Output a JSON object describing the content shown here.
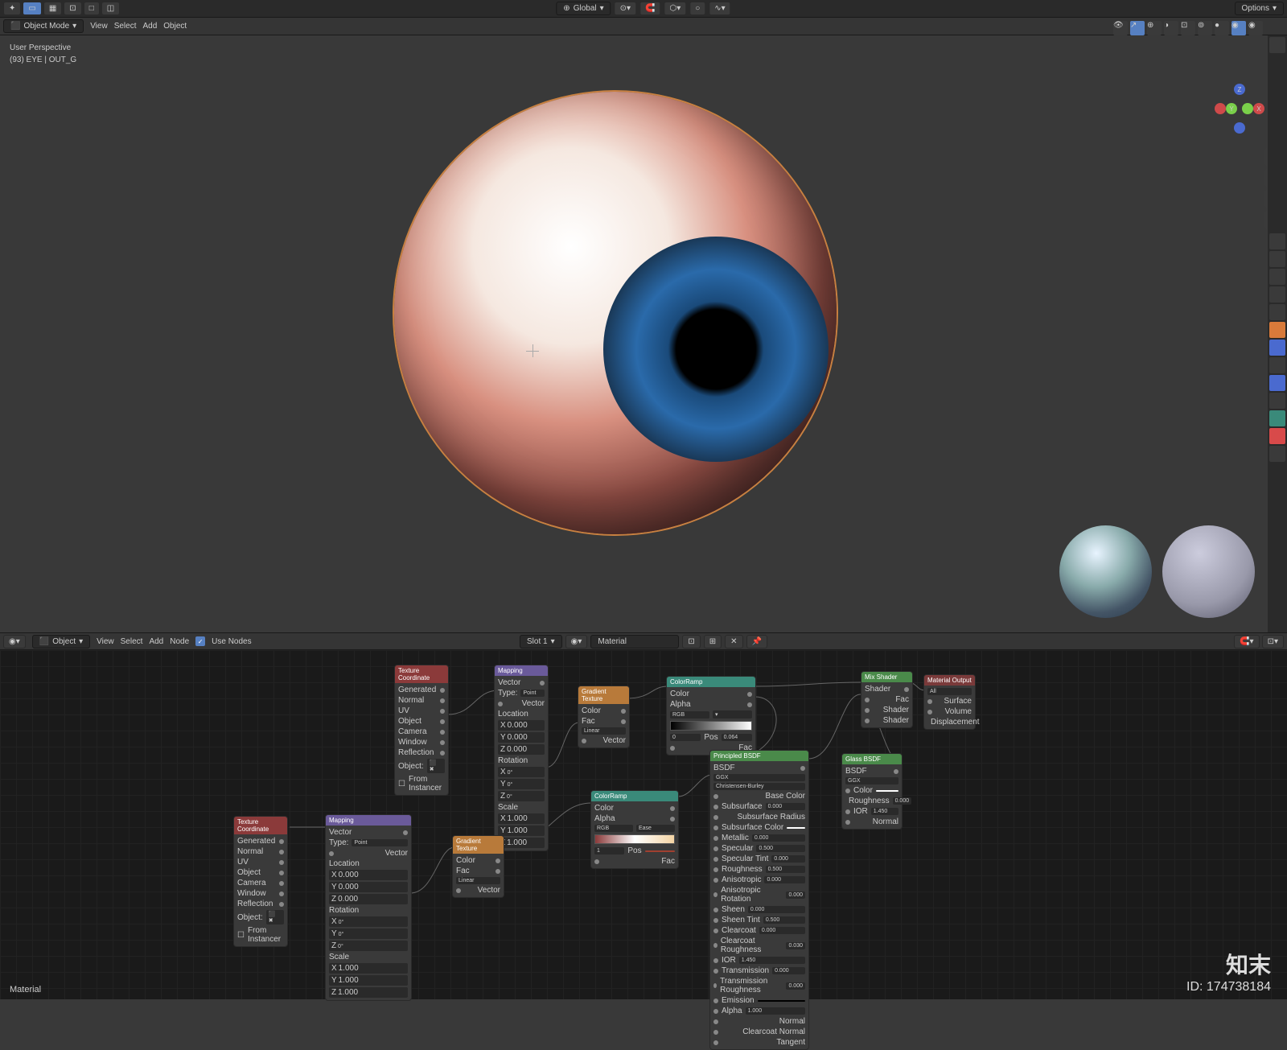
{
  "topbar": {
    "orientation": "Global",
    "options": "Options"
  },
  "header": {
    "mode": "Object Mode",
    "view": "View",
    "select": "Select",
    "add": "Add",
    "object": "Object"
  },
  "viewport": {
    "perspective": "User Perspective",
    "collection": "(93) EYE | OUT_G"
  },
  "nodeHeader": {
    "object": "Object",
    "view": "View",
    "select": "Select",
    "add": "Add",
    "node": "Node",
    "useNodes": "Use Nodes",
    "slot": "Slot 1",
    "material": "Material"
  },
  "nodes": {
    "texcoord": {
      "title": "Texture Coordinate",
      "outs": [
        "Generated",
        "Normal",
        "UV",
        "Object",
        "Camera",
        "Window",
        "Reflection"
      ],
      "obj": "Object:",
      "fi": "From Instancer"
    },
    "mapping": {
      "title": "Mapping",
      "vectorOut": "Vector",
      "type": "Type:",
      "point": "Point",
      "vector": "Vector",
      "location": "Location",
      "rotation": "Rotation",
      "scale": "Scale",
      "x": "X",
      "y": "Y",
      "z": "Z",
      "v0": "0.000",
      "v1": "1.000"
    },
    "gradtex": {
      "title": "Gradient Texture",
      "color": "Color",
      "fac": "Fac",
      "linear": "Linear",
      "vector": "Vector"
    },
    "colorramp1": {
      "title": "ColorRamp",
      "color": "Color",
      "alpha": "Alpha",
      "rgb": "RGB",
      "pos": "Pos",
      "posv": "0.064",
      "fac": "Fac"
    },
    "colorramp2": {
      "title": "ColorRamp",
      "color": "Color",
      "alpha": "Alpha",
      "rgb": "RGB",
      "ease": "Ease",
      "pos": "Pos",
      "fac": "Fac"
    },
    "mix": {
      "title": "Mix Shader",
      "shader": "Shader",
      "fac": "Fac"
    },
    "matout": {
      "title": "Material Output",
      "surface": "Surface",
      "volume": "Volume",
      "displacement": "Displacement",
      "all": "All"
    },
    "bsdf": {
      "title": "Principled BSDF",
      "out": "BSDF",
      "ggx": "GGX",
      "cb": "Christensen-Burley",
      "base": "Base Color",
      "sub": "Subsurface",
      "subr": "Subsurface Radius",
      "subc": "Subsurface Color",
      "met": "Metallic",
      "spec": "Specular",
      "spect": "Specular Tint",
      "rough": "Roughness",
      "aniso": "Anisotropic",
      "anisor": "Anisotropic Rotation",
      "sheen": "Sheen",
      "sheent": "Sheen Tint",
      "clear": "Clearcoat",
      "clearr": "Clearcoat Roughness",
      "ior": "IOR",
      "trans": "Transmission",
      "transr": "Transmission Roughness",
      "emis": "Emission",
      "alpha": "Alpha",
      "norm": "Normal",
      "clearn": "Clearcoat Normal",
      "tang": "Tangent",
      "v0": "0.000",
      "v05": "0.500",
      "v1": "1.000",
      "v145": "1.450",
      "v003": "0.030"
    },
    "glass": {
      "title": "Glass BSDF",
      "out": "BSDF",
      "ggx": "GGX",
      "color": "Color",
      "rough": "Roughness",
      "ior": "IOR",
      "norm": "Normal",
      "v0": "0.000",
      "v145": "1.450"
    }
  },
  "footer": "Material",
  "watermark": {
    "brand": "知末",
    "id": "ID: 174738184"
  }
}
